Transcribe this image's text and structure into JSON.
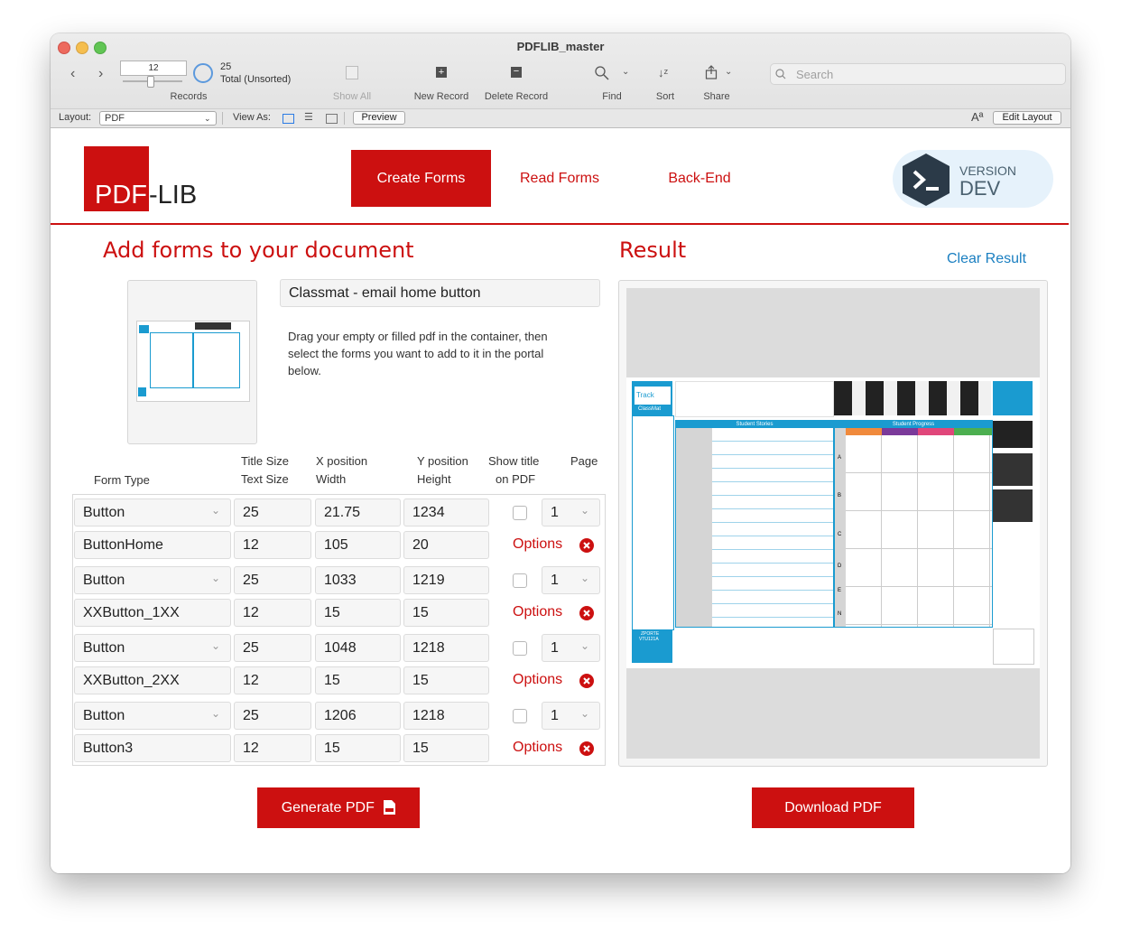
{
  "window": {
    "title": "PDFLIB_master"
  },
  "toolbar": {
    "record_number": "12",
    "found_count": "25",
    "total_label": "Total (Unsorted)",
    "records_label": "Records",
    "show_all": "Show All",
    "new_record": "New Record",
    "delete_record": "Delete Record",
    "find": "Find",
    "sort": "Sort",
    "share": "Share",
    "search_placeholder": "Search"
  },
  "layoutbar": {
    "layout_label": "Layout:",
    "layout_value": "PDF",
    "view_as_label": "View As:",
    "preview": "Preview",
    "text_size": "Aª",
    "edit_layout": "Edit Layout"
  },
  "header": {
    "logo_left": "PDF",
    "logo_right": "-LIB",
    "nav": [
      "Create Forms",
      "Read Forms",
      "Back-End"
    ],
    "version_label": "VERSION",
    "version_value": "DEV"
  },
  "left": {
    "title": "Add forms to your document",
    "doc_name": "Classmat - email home button",
    "instructions": "Drag your empty or filled pdf in the container, then select the forms you want to add to it in the portal below.",
    "columns": {
      "form_type": "Form Type",
      "title_size": "Title Size",
      "text_size": "Text Size",
      "x_position": "X position",
      "width": "Width",
      "y_position": "Y position",
      "height": "Height",
      "show_title": "Show title",
      "on_pdf": "on PDF",
      "page": "Page"
    },
    "rows": [
      {
        "type": "Button",
        "title_size": "25",
        "x": "21.75",
        "y": "1234",
        "page": "1",
        "name": "ButtonHome",
        "text_size": "12",
        "width": "105",
        "height": "20",
        "options": "Options"
      },
      {
        "type": "Button",
        "title_size": "25",
        "x": "1033",
        "y": "1219",
        "page": "1",
        "name": "XXButton_1XX",
        "text_size": "12",
        "width": "15",
        "height": "15",
        "options": "Options"
      },
      {
        "type": "Button",
        "title_size": "25",
        "x": "1048",
        "y": "1218",
        "page": "1",
        "name": "XXButton_2XX",
        "text_size": "12",
        "width": "15",
        "height": "15",
        "options": "Options"
      },
      {
        "type": "Button",
        "title_size": "25",
        "x": "1206",
        "y": "1218",
        "page": "1",
        "name": "Button3",
        "text_size": "12",
        "width": "15",
        "height": "15",
        "options": "Options"
      }
    ],
    "generate_btn": "Generate PDF"
  },
  "right": {
    "title": "Result",
    "clear": "Clear Result",
    "download_btn": "Download PDF",
    "preview": {
      "track": "Track",
      "classmat": "ClassMat",
      "student_stories": "Student Stories",
      "student_progress": "Student Progress",
      "grades": [
        "A",
        "B",
        "C",
        "D",
        "E",
        "N"
      ],
      "sport": "ZPORTE",
      "code": "VTU121A"
    }
  },
  "colors": {
    "brand_red": "#cc1010",
    "link_blue": "#1a7fc1",
    "teal": "#1a9bd0"
  }
}
